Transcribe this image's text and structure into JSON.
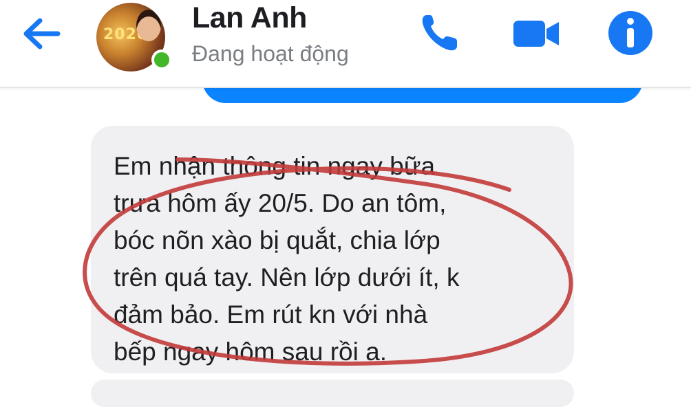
{
  "header": {
    "contact_name": "Lan Anh",
    "status": "Đang hoạt động",
    "avatar_text": "2020",
    "online": true,
    "accent_color": "#1877f2",
    "online_color": "#42b72a",
    "icons": [
      "back-arrow-icon",
      "phone-icon",
      "video-camera-icon",
      "info-icon"
    ]
  },
  "messages": [
    {
      "type": "sent",
      "text": "",
      "color": "#0a84ff"
    },
    {
      "type": "received",
      "text": "Em nhận thông tin ngay bữa\ntrưa hôm ấy 20/5. Do an tôm,\nbóc nõn xào bị quắt,  chia lớp\ntrên quá tay.  Nên lớp dưới ít,  k\nđảm bảo.  Em rút kn với nhà\nbếp ngay hôm sau rồi a.",
      "color": "#f0f0f2"
    },
    {
      "type": "received",
      "text": "",
      "color": "#f0f0f2"
    }
  ],
  "annotation": {
    "shape": "hand-drawn ellipse",
    "color": "#c0392b"
  }
}
